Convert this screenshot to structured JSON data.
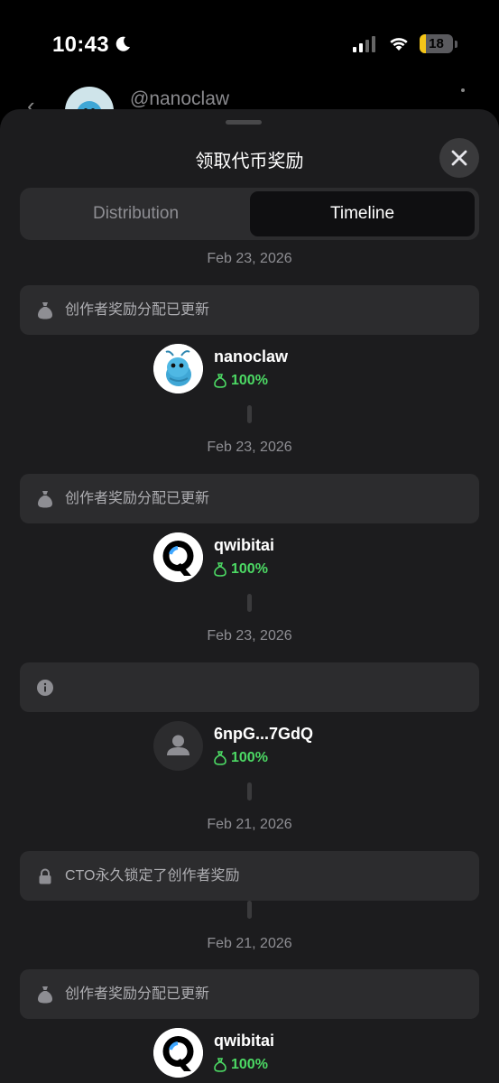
{
  "status_bar": {
    "time": "10:43",
    "battery": "18",
    "battery_level": 0.18
  },
  "background": {
    "username": "@nanoclaw"
  },
  "sheet": {
    "title": "领取代币奖励",
    "tabs": [
      {
        "label": "Distribution",
        "active": false
      },
      {
        "label": "Timeline",
        "active": true
      }
    ]
  },
  "timeline": [
    {
      "date": "Feb 23, 2026",
      "event_icon": "moneybag-icon",
      "event_text": "创作者奖励分配已更新",
      "user": {
        "name": "nanoclaw",
        "share": "100%",
        "avatar": "shrimp"
      }
    },
    {
      "date": "Feb 23, 2026",
      "event_icon": "moneybag-icon",
      "event_text": "创作者奖励分配已更新",
      "user": {
        "name": "qwibitai",
        "share": "100%",
        "avatar": "q-logo"
      }
    },
    {
      "date": "Feb 23, 2026",
      "event_icon": "info-icon",
      "event_text": "",
      "user": {
        "name": "6npG...7GdQ",
        "share": "100%",
        "avatar": "default"
      }
    },
    {
      "date": "Feb 21, 2026",
      "event_icon": "lock-icon",
      "event_text": "CTO永久锁定了创作者奖励"
    },
    {
      "date": "Feb 21, 2026",
      "event_icon": "moneybag-icon",
      "event_text": "创作者奖励分配已更新",
      "user": {
        "name": "qwibitai",
        "share": "100%",
        "avatar": "q-logo"
      }
    }
  ],
  "colors": {
    "sheet_bg": "#1c1c1e",
    "card_bg": "#2c2c2e",
    "accent_green": "#4cd964",
    "muted_text": "#8e8e93"
  }
}
